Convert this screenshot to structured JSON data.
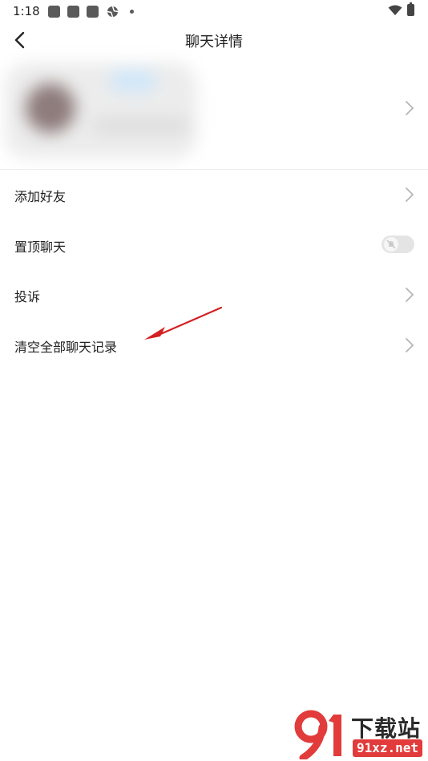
{
  "status_bar": {
    "time": "1:18"
  },
  "header": {
    "title": "聊天详情"
  },
  "menu": {
    "items": [
      {
        "label": "添加好友",
        "control": "chevron-right-icon"
      },
      {
        "label": "置顶聊天",
        "control": "toggle",
        "toggle_on": false
      },
      {
        "label": "投诉",
        "control": "chevron-right-icon"
      },
      {
        "label": "清空全部聊天记录",
        "control": "chevron-right-icon"
      }
    ]
  },
  "watermark": {
    "logo_text": "91",
    "title": "下载站",
    "domain": "91xz.net"
  },
  "colors": {
    "background": "#ffffff",
    "text": "#222222",
    "chevron": "#b5b5b5",
    "annotation_arrow": "#d42020",
    "watermark_red": "#e23b3b"
  }
}
